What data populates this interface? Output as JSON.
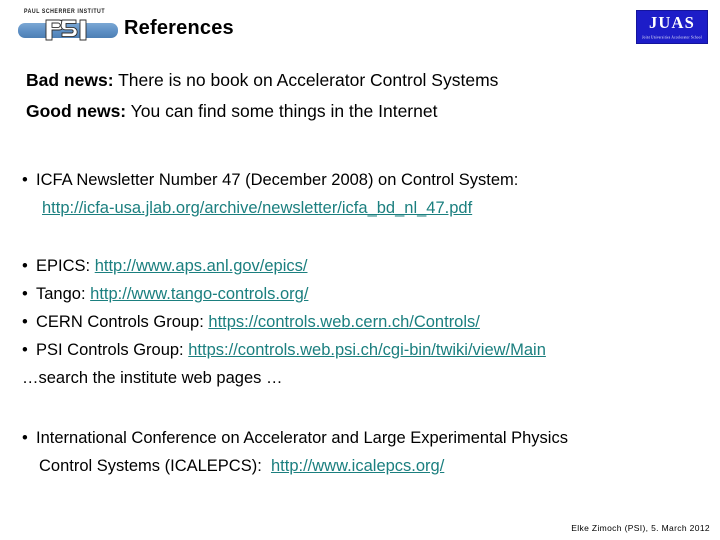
{
  "header": {
    "title": "References",
    "psi_logo": {
      "wordmark": "PAUL SCHERRER INSTITUT",
      "letters": "PSI",
      "bar_color": "#5d8fc4"
    },
    "juas_logo": {
      "name": "JUAS",
      "subtitle": "Joint Universities Accelerator School",
      "background_color": "#1d1dc8"
    }
  },
  "colors": {
    "link": "#1b7f7f",
    "text": "#000000",
    "background": "#ffffff"
  },
  "body": {
    "news": [
      {
        "lead": "Bad news:",
        "rest": " There is no book on Accelerator Control Systems"
      },
      {
        "lead": "Good news:",
        "rest": " You can find some things in the Internet"
      }
    ],
    "icfa": {
      "bullet": "•",
      "text": "ICFA Newsletter Number 47 (December 2008) on Control System:",
      "url": "http://icfa-usa.jlab.org/archive/newsletter/icfa_bd_nl_47.pdf"
    },
    "links": [
      {
        "bullet": "•",
        "label": "EPICS:",
        "url": "http://www.aps.anl.gov/epics/"
      },
      {
        "bullet": "•",
        "label": "Tango:",
        "url": "http://www.tango-controls.org/"
      },
      {
        "bullet": "•",
        "label": "CERN Controls Group:",
        "url": "https://controls.web.cern.ch/Controls/"
      },
      {
        "bullet": "•",
        "label": "PSI Controls Group:",
        "url": "https://controls.web.psi.ch/cgi-bin/twiki/view/Main"
      }
    ],
    "search_note": "…search the institute web pages …",
    "conference": {
      "bullet": "•",
      "line1": "International Conference on Accelerator and Large Experimental Physics",
      "line2": "Control Systems (ICALEPCS):",
      "url": "http://www.icalepcs.org/"
    }
  },
  "footer": {
    "text": "Elke Zimoch (PSI), 5. March 2012"
  }
}
